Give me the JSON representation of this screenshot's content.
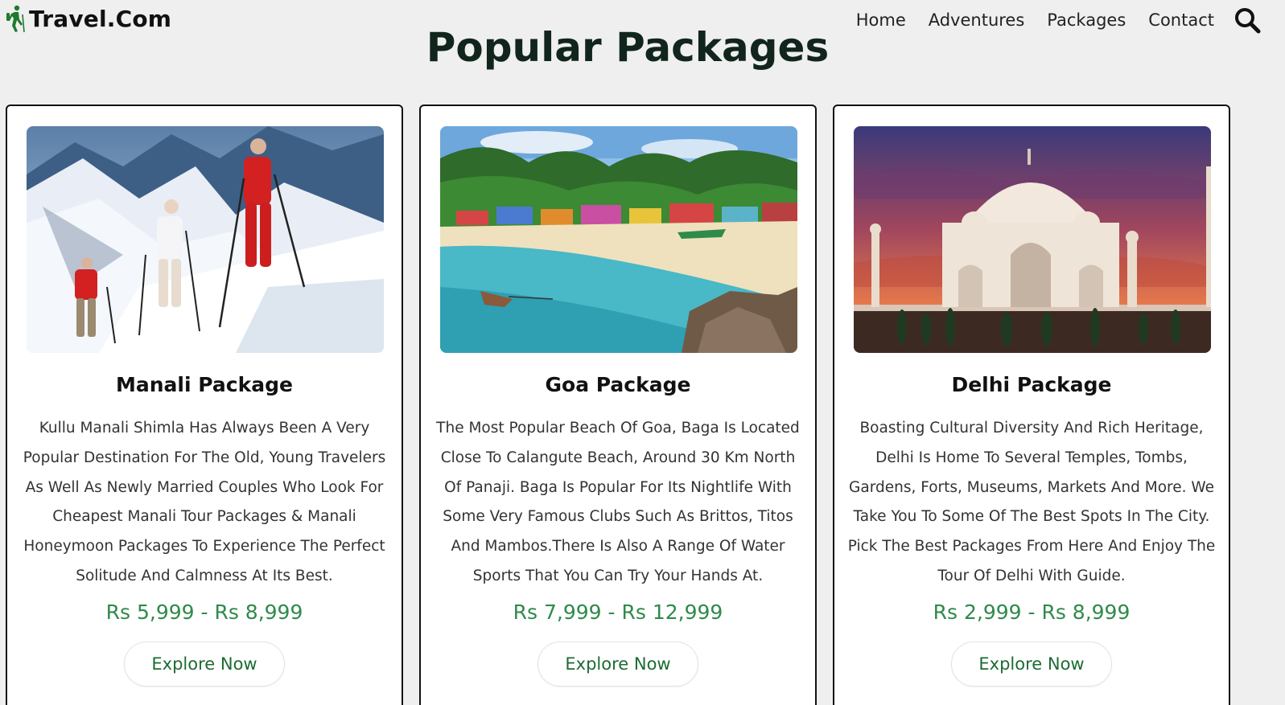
{
  "brand": {
    "name": "Travel.Com",
    "icon": "hiker-icon",
    "accent_color": "#1f7a2e"
  },
  "nav": {
    "items": [
      {
        "label": "Home"
      },
      {
        "label": "Adventures"
      },
      {
        "label": "Packages"
      },
      {
        "label": "Contact"
      }
    ],
    "search_icon": "search-icon"
  },
  "section": {
    "title": "Popular Packages"
  },
  "cards": [
    {
      "title": "Manali Package",
      "image": "snowy-mountain-skiers-photo",
      "description": "Kullu Manali Shimla Has Always Been A Very Popular Destination For The Old, Young Travelers As Well As Newly Married Couples Who Look For Cheapest Manali Tour Packages & Manali Honeymoon Packages To Experience The Perfect Solitude And Calmness At Its Best.",
      "price": "Rs 5,999 - Rs 8,999",
      "button": "Explore Now"
    },
    {
      "title": "Goa Package",
      "image": "goa-beach-palms-photo",
      "description": "The Most Popular Beach Of Goa, Baga Is Located Close To Calangute Beach, Around 30 Km North Of Panaji. Baga Is Popular For Its Nightlife With Some Very Famous Clubs Such As Brittos, Titos And Mambos.There Is Also A Range Of Water Sports That You Can Try Your Hands At.",
      "price": "Rs 7,999 - Rs 12,999",
      "button": "Explore Now"
    },
    {
      "title": "Delhi Package",
      "image": "taj-mahal-sunset-photo",
      "description": "Boasting Cultural Diversity And Rich Heritage, Delhi Is Home To Several Temples, Tombs, Gardens, Forts, Museums, Markets And More. We Take You To Some Of The Best Spots In The City. Pick The Best Packages From Here And Enjoy The Tour Of Delhi With Guide.",
      "price": "Rs 2,999 - Rs 8,999",
      "button": "Explore Now"
    }
  ],
  "colors": {
    "background": "#efefef",
    "price": "#2f8a4b",
    "button_text": "#1d6b33",
    "title": "#11251c"
  }
}
